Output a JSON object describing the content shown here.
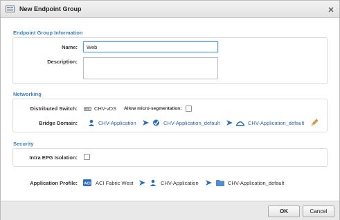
{
  "window": {
    "title": "New Endpoint Group",
    "close_glyph": "✕"
  },
  "sections": {
    "info": {
      "header": "Endpoint Group Information"
    },
    "networking": {
      "header": "Networking"
    },
    "security": {
      "header": "Security"
    }
  },
  "fields": {
    "name": {
      "label": "Name:",
      "value": "Web"
    },
    "description": {
      "label": "Description:",
      "value": ""
    },
    "distributed_switch": {
      "label": "Distributed Switch:",
      "value": "CHV-vDS",
      "micro_seg_label": "Allow micro-segmentation:",
      "micro_seg_checked": false
    },
    "bridge_domain": {
      "label": "Bridge Domain:",
      "tenant": "CHV-Application",
      "vrf": "CHV-Application_default",
      "bd": "CHV-Application_default"
    },
    "intra_epg_isolation": {
      "label": "Intra EPG Isolation:",
      "checked": false
    },
    "application_profile": {
      "label": "Application Profile:",
      "fabric": "ACI Fabric West",
      "tenant": "CHV-Application",
      "profile": "CHV-Application_default"
    }
  },
  "buttons": {
    "ok": "OK",
    "cancel": "Cancel"
  },
  "icons": [
    "endpoint-group-icon",
    "close-icon",
    "switch-icon",
    "tenant-icon",
    "arrow-right-icon",
    "vrf-icon",
    "bridge-domain-icon",
    "edit-pencil-icon",
    "aci-fabric-icon",
    "app-profile-icon"
  ],
  "colors": {
    "section_header": "#3d7fba",
    "link": "#2a66aa",
    "input_focus": "#5d9bd2",
    "pencil": "#e0a53a"
  }
}
